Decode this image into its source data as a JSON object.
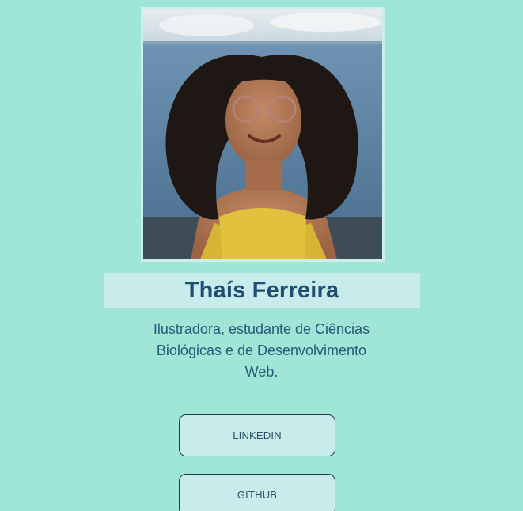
{
  "profile": {
    "photo": {
      "subject": "portrait-photo",
      "icon": "profile-photo"
    },
    "name": "Thaís Ferreira",
    "bio": "Ilustradora, estudante de Ciências Biológicas e de Desenvolvimento Web."
  },
  "links": [
    {
      "label": "LINKEDIN"
    },
    {
      "label": "GITHUB"
    }
  ],
  "colors": {
    "background": "#a0e6d7",
    "panel": "#c8ecec",
    "text_primary": "#1e4f73",
    "text_secondary": "#285a7a",
    "button_border": "#1f3a52"
  }
}
